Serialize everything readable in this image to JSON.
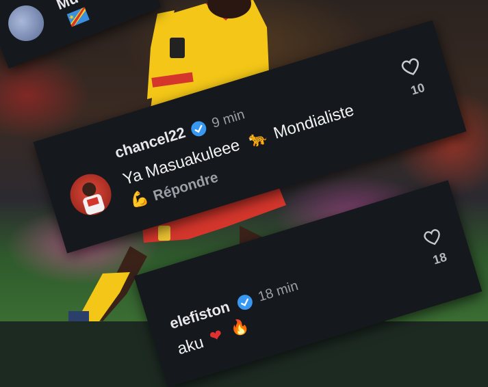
{
  "comments": [
    {
      "name_partial": "Mu",
      "flag_icon": "flag-dr-congo-icon"
    },
    {
      "username": "chancel22",
      "time": "9 min",
      "text_part1": "Ya Masuakuleee",
      "emoji1": "leopard-emoji",
      "text_part2": "Mondialiste",
      "emoji2": "flexed-biceps-emoji",
      "reply_label": "Répondre",
      "likes": "10"
    },
    {
      "username": "elefiston",
      "time": "18 min",
      "text_partial": "aku",
      "emoji1": "red-heart-emoji",
      "emoji2": "fire-emoji",
      "likes": "18"
    }
  ],
  "colors": {
    "card_bg": "#15181d",
    "verified_blue": "#3897f0",
    "kit_yellow": "#f3c617",
    "kit_red": "#d4362c"
  }
}
